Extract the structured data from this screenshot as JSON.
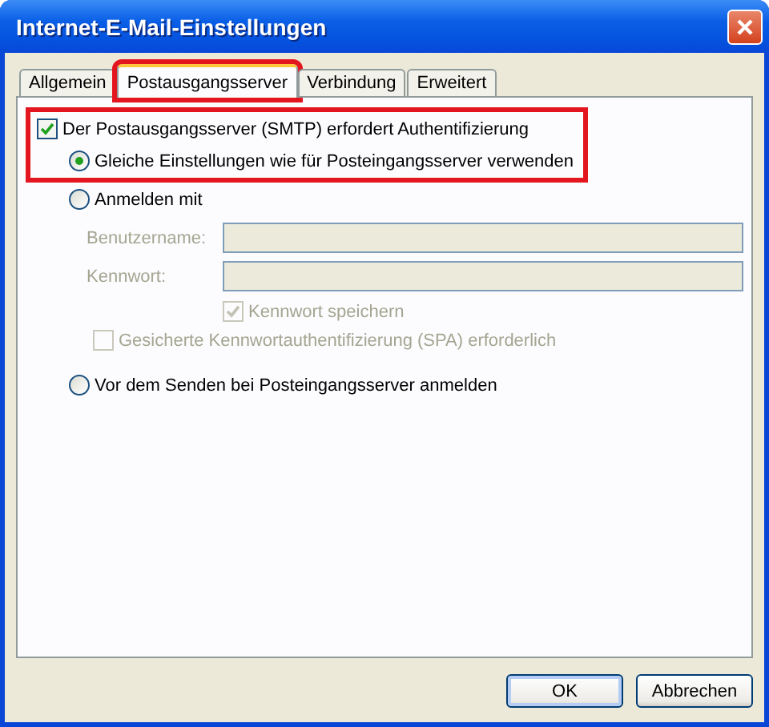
{
  "window": {
    "title": "Internet-E-Mail-Einstellungen"
  },
  "tabs": [
    {
      "label": "Allgemein",
      "selected": false,
      "highlighted": false
    },
    {
      "label": "Postausgangsserver",
      "selected": true,
      "highlighted": true
    },
    {
      "label": "Verbindung",
      "selected": false,
      "highlighted": false
    },
    {
      "label": "Erweitert",
      "selected": false,
      "highlighted": false
    }
  ],
  "auth": {
    "label": "Der Postausgangsserver (SMTP) erfordert Authentifizierung",
    "checked": true,
    "highlighted": true,
    "same_settings": {
      "label": "Gleiche Einstellungen wie für Posteingangsserver verwenden",
      "selected": true
    }
  },
  "login": {
    "label": "Anmelden mit",
    "selected": false,
    "fields": [
      {
        "label": "Benutzername:",
        "disabled": true
      },
      {
        "label": "Kennwort:",
        "disabled": true
      }
    ],
    "checkboxes": [
      {
        "label": "Kennwort speichern",
        "checked": true,
        "disabled": true,
        "kind": "under-fields"
      },
      {
        "label": "Gesicherte Kennwortauthentifizierung (SPA) erforderlich",
        "checked": false,
        "disabled": true,
        "kind": "full"
      }
    ]
  },
  "pop_before": {
    "label": "Vor dem Senden bei Posteingangsserver anmelden",
    "selected": false
  },
  "buttons": [
    {
      "label": "OK",
      "kind": "default"
    },
    {
      "label": "Abbrechen",
      "kind": "normal"
    }
  ]
}
